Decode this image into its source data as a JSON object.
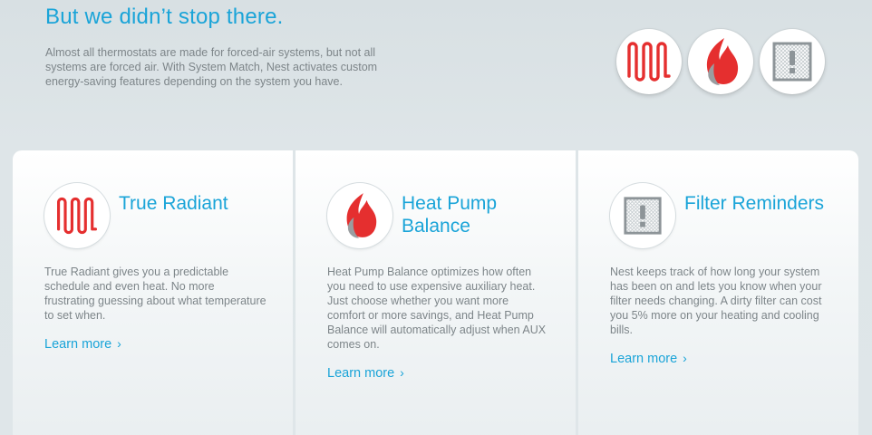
{
  "hero": {
    "title": "But we didn’t stop there.",
    "description": "Almost all thermostats are made for forced-air systems, but not all systems are forced air. With System Match, Nest activates custom energy-saving features depending on the system you have.",
    "icons": [
      "radiant-heat-icon",
      "flame-icon",
      "filter-alert-icon"
    ]
  },
  "features": [
    {
      "icon": "radiant-heat-icon",
      "title": "True Radiant",
      "description": "True Radiant gives you a predictable schedule and even heat. No more frustrating guessing about what temperature to set when.",
      "link": "Learn more",
      "link_icon": "chevron-right-icon"
    },
    {
      "icon": "flame-icon",
      "title": "Heat Pump Balance",
      "description": "Heat Pump Balance optimizes how often you need to use expensive auxiliary heat. Just choose whether you want more comfort or more savings, and Heat Pump Balance will automatically adjust when AUX comes on.",
      "link": "Learn more",
      "link_icon": "chevron-right-icon"
    },
    {
      "icon": "filter-alert-icon",
      "title": "Filter Reminders",
      "description": "Nest keeps track of how long your system has been on and lets you know when your filter needs changing. A dirty filter can cost you 5% more on your heating and cooling bills.",
      "link": "Learn more",
      "link_icon": "chevron-right-icon"
    }
  ],
  "colors": {
    "accent": "#1aa4d8",
    "radiant_red": "#e52f2f",
    "flame_red": "#e52f2f",
    "flame_gray": "#9a9da0",
    "text_gray": "#7d8589"
  }
}
